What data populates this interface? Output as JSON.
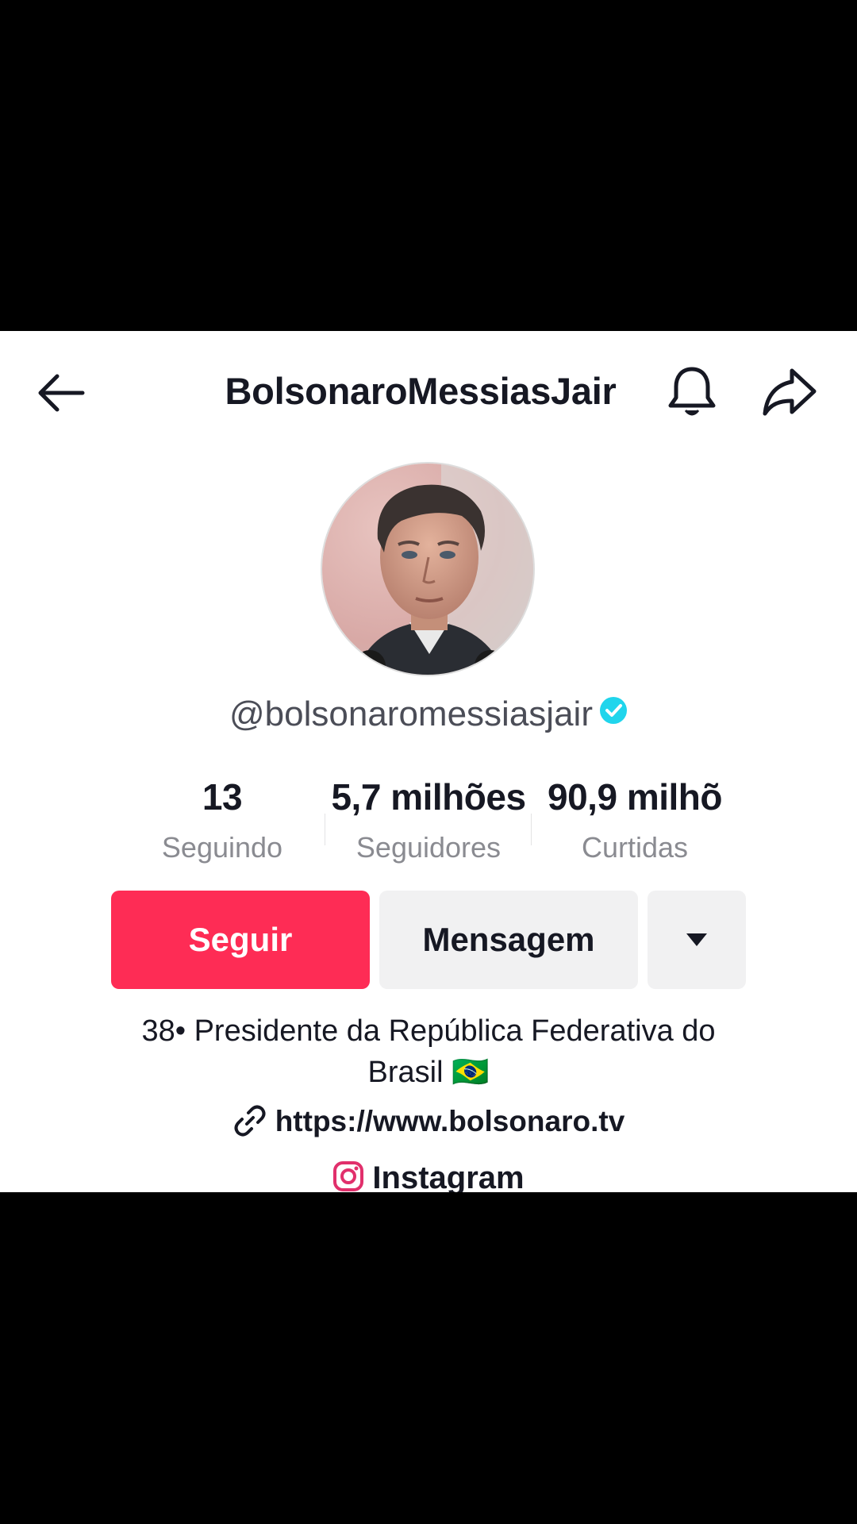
{
  "header": {
    "title": "BolsonaroMessiasJair",
    "back_icon": "arrow-left-icon",
    "bell_icon": "bell-icon",
    "share_icon": "share-arrow-icon"
  },
  "profile": {
    "handle": "@bolsonaromessiasjair",
    "verified": true,
    "verified_color": "#20d5ec"
  },
  "stats": [
    {
      "value": "13",
      "label": "Seguindo"
    },
    {
      "value": "5,7 milhões",
      "label": "Seguidores"
    },
    {
      "value": "90,9 milhõ",
      "label": "Curtidas"
    }
  ],
  "actions": {
    "follow_label": "Seguir",
    "message_label": "Mensagem",
    "more_icon": "caret-down-icon",
    "follow_color": "#fe2c55"
  },
  "bio": {
    "line1": "38• Presidente da República Federativa do",
    "line2": "Brasil 🇧🇷"
  },
  "links": {
    "website": "https://www.bolsonaro.tv",
    "instagram": "Instagram"
  }
}
